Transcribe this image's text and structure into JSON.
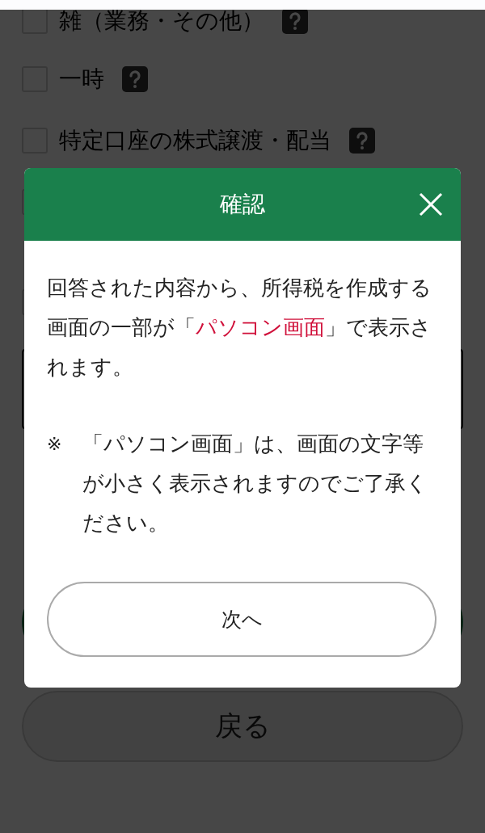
{
  "options": [
    {
      "label": "雑（業務・その他）",
      "checked": false,
      "help": true
    },
    {
      "label": "一時",
      "checked": false,
      "help": true
    },
    {
      "label": "特定口座の株式譲渡・配当",
      "checked": false,
      "help": true
    }
  ],
  "hidden_options": [
    {
      "checked": false
    },
    {
      "checked": false
    }
  ],
  "buttons": [
    {
      "label": "戻る",
      "kind": "secondary"
    }
  ],
  "dialog": {
    "title": "確認",
    "message": [
      {
        "text": "回答された内容から、所得税を作成する画面の一部が「",
        "highlight": false
      },
      {
        "text": "パソコン画面",
        "highlight": true
      },
      {
        "text": "」で表示されます。",
        "highlight": false
      }
    ],
    "note_mark": "※",
    "note": "「パソコン画面」は、画面の文字等が小さく表示されますのでご了承ください。",
    "button": "次へ"
  }
}
